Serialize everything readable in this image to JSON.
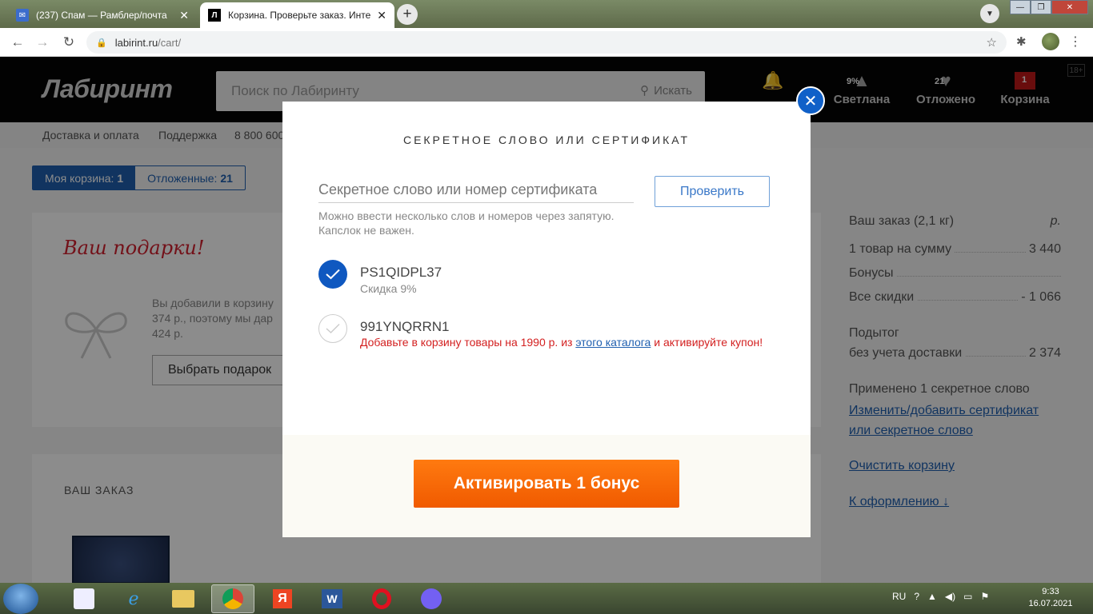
{
  "browser": {
    "tabs": [
      {
        "title": "(237) Спам — Рамблер/почта",
        "active": false
      },
      {
        "title": "Корзина. Проверьте заказ. Инте",
        "active": true
      }
    ],
    "url_host": "labirint.ru",
    "url_path": "/cart/"
  },
  "site": {
    "logo": "Лабиринт",
    "search_placeholder": "Поиск по Лабиринту",
    "search_button": "Искать",
    "header_items": [
      {
        "label": "Светлана",
        "badge": "9%"
      },
      {
        "label": "Отложено",
        "badge": "21"
      },
      {
        "label": "Корзина",
        "badge": "1"
      }
    ],
    "age_rating": "18+",
    "subnav": [
      "Доставка и оплата",
      "Поддержка",
      "8 800 600"
    ]
  },
  "cart_tabs": [
    {
      "label": "Моя корзина: ",
      "count": "1"
    },
    {
      "label": "Отложенные: ",
      "count": "21"
    }
  ],
  "gifts": {
    "title": "Ваш подарки!",
    "text_lines": [
      "Вы добавили в корзину",
      "374 р., поэтому мы дар",
      "424 р."
    ],
    "button": "Выбрать подарок"
  },
  "order_label": "ВАШ ЗАКАЗ",
  "summary": {
    "order_weight_label": "Ваш заказ (2,1 кг)",
    "currency": "р.",
    "items_label": "1 товар на сумму",
    "items_value": "3 440",
    "bonuses_label": "Бонусы",
    "discounts_label": "Все скидки",
    "discounts_value": "- 1 066",
    "subtotal_label": "Подытог",
    "subtotal_sub": "без учета доставки",
    "subtotal_value": "2 374",
    "applied": "Применено 1 секретное слово",
    "change_link_1": "Изменить/добавить сертификат",
    "change_link_2": "или секретное слово",
    "clear_link": "Очистить корзину",
    "checkout_link": "К оформлению ↓"
  },
  "modal": {
    "title": "СЕКРЕТНОЕ СЛОВО ИЛИ СЕРТИФИКАТ",
    "input_placeholder": "Секретное слово или номер сертификата",
    "check_button": "Проверить",
    "hint_line1": "Можно ввести несколько слов и номеров через запятую.",
    "hint_line2": "Капслок не важен.",
    "codes": [
      {
        "code": "PS1QIDPL37",
        "note": "Скидка 9%",
        "applied": true
      },
      {
        "code": "991YNQRRN1",
        "warning_pre": "Добавьте в корзину товары на 1990 р. из ",
        "warning_link": "этого каталога",
        "warning_post": " и активируйте купон!",
        "applied": false
      }
    ],
    "activate_button": "Активировать 1 бонус"
  },
  "taskbar": {
    "lang": "RU",
    "time": "9:33",
    "date": "16.07.2021"
  }
}
